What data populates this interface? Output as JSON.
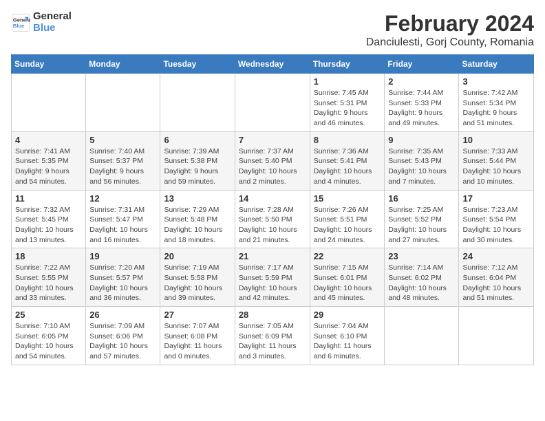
{
  "logo": {
    "general": "General",
    "blue": "Blue"
  },
  "title": "February 2024",
  "subtitle": "Danciulesti, Gorj County, Romania",
  "days_header": [
    "Sunday",
    "Monday",
    "Tuesday",
    "Wednesday",
    "Thursday",
    "Friday",
    "Saturday"
  ],
  "weeks": [
    [
      {
        "day": "",
        "info": ""
      },
      {
        "day": "",
        "info": ""
      },
      {
        "day": "",
        "info": ""
      },
      {
        "day": "",
        "info": ""
      },
      {
        "day": "1",
        "info": "Sunrise: 7:45 AM\nSunset: 5:31 PM\nDaylight: 9 hours and 46 minutes."
      },
      {
        "day": "2",
        "info": "Sunrise: 7:44 AM\nSunset: 5:33 PM\nDaylight: 9 hours and 49 minutes."
      },
      {
        "day": "3",
        "info": "Sunrise: 7:42 AM\nSunset: 5:34 PM\nDaylight: 9 hours and 51 minutes."
      }
    ],
    [
      {
        "day": "4",
        "info": "Sunrise: 7:41 AM\nSunset: 5:35 PM\nDaylight: 9 hours and 54 minutes."
      },
      {
        "day": "5",
        "info": "Sunrise: 7:40 AM\nSunset: 5:37 PM\nDaylight: 9 hours and 56 minutes."
      },
      {
        "day": "6",
        "info": "Sunrise: 7:39 AM\nSunset: 5:38 PM\nDaylight: 9 hours and 59 minutes."
      },
      {
        "day": "7",
        "info": "Sunrise: 7:37 AM\nSunset: 5:40 PM\nDaylight: 10 hours and 2 minutes."
      },
      {
        "day": "8",
        "info": "Sunrise: 7:36 AM\nSunset: 5:41 PM\nDaylight: 10 hours and 4 minutes."
      },
      {
        "day": "9",
        "info": "Sunrise: 7:35 AM\nSunset: 5:43 PM\nDaylight: 10 hours and 7 minutes."
      },
      {
        "day": "10",
        "info": "Sunrise: 7:33 AM\nSunset: 5:44 PM\nDaylight: 10 hours and 10 minutes."
      }
    ],
    [
      {
        "day": "11",
        "info": "Sunrise: 7:32 AM\nSunset: 5:45 PM\nDaylight: 10 hours and 13 minutes."
      },
      {
        "day": "12",
        "info": "Sunrise: 7:31 AM\nSunset: 5:47 PM\nDaylight: 10 hours and 16 minutes."
      },
      {
        "day": "13",
        "info": "Sunrise: 7:29 AM\nSunset: 5:48 PM\nDaylight: 10 hours and 18 minutes."
      },
      {
        "day": "14",
        "info": "Sunrise: 7:28 AM\nSunset: 5:50 PM\nDaylight: 10 hours and 21 minutes."
      },
      {
        "day": "15",
        "info": "Sunrise: 7:26 AM\nSunset: 5:51 PM\nDaylight: 10 hours and 24 minutes."
      },
      {
        "day": "16",
        "info": "Sunrise: 7:25 AM\nSunset: 5:52 PM\nDaylight: 10 hours and 27 minutes."
      },
      {
        "day": "17",
        "info": "Sunrise: 7:23 AM\nSunset: 5:54 PM\nDaylight: 10 hours and 30 minutes."
      }
    ],
    [
      {
        "day": "18",
        "info": "Sunrise: 7:22 AM\nSunset: 5:55 PM\nDaylight: 10 hours and 33 minutes."
      },
      {
        "day": "19",
        "info": "Sunrise: 7:20 AM\nSunset: 5:57 PM\nDaylight: 10 hours and 36 minutes."
      },
      {
        "day": "20",
        "info": "Sunrise: 7:19 AM\nSunset: 5:58 PM\nDaylight: 10 hours and 39 minutes."
      },
      {
        "day": "21",
        "info": "Sunrise: 7:17 AM\nSunset: 5:59 PM\nDaylight: 10 hours and 42 minutes."
      },
      {
        "day": "22",
        "info": "Sunrise: 7:15 AM\nSunset: 6:01 PM\nDaylight: 10 hours and 45 minutes."
      },
      {
        "day": "23",
        "info": "Sunrise: 7:14 AM\nSunset: 6:02 PM\nDaylight: 10 hours and 48 minutes."
      },
      {
        "day": "24",
        "info": "Sunrise: 7:12 AM\nSunset: 6:04 PM\nDaylight: 10 hours and 51 minutes."
      }
    ],
    [
      {
        "day": "25",
        "info": "Sunrise: 7:10 AM\nSunset: 6:05 PM\nDaylight: 10 hours and 54 minutes."
      },
      {
        "day": "26",
        "info": "Sunrise: 7:09 AM\nSunset: 6:06 PM\nDaylight: 10 hours and 57 minutes."
      },
      {
        "day": "27",
        "info": "Sunrise: 7:07 AM\nSunset: 6:08 PM\nDaylight: 11 hours and 0 minutes."
      },
      {
        "day": "28",
        "info": "Sunrise: 7:05 AM\nSunset: 6:09 PM\nDaylight: 11 hours and 3 minutes."
      },
      {
        "day": "29",
        "info": "Sunrise: 7:04 AM\nSunset: 6:10 PM\nDaylight: 11 hours and 6 minutes."
      },
      {
        "day": "",
        "info": ""
      },
      {
        "day": "",
        "info": ""
      }
    ]
  ]
}
